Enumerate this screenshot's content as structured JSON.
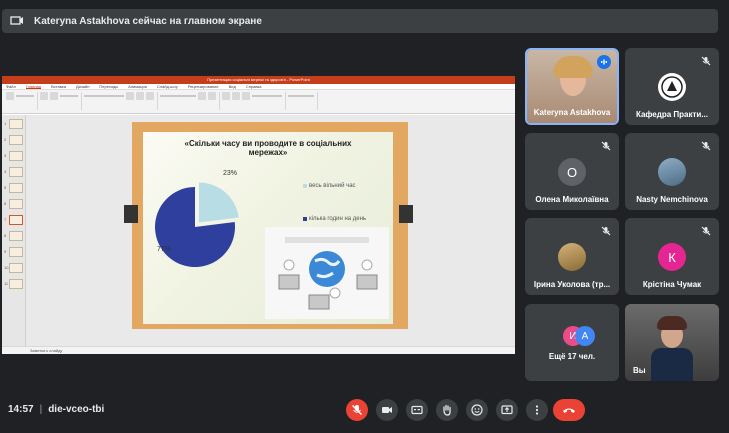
{
  "banner": {
    "text": "Kateryna Astakhova сейчас на главном экране"
  },
  "presentation": {
    "app_title": "Презентация соціальні мережі та здоров'я - PowerPoint",
    "tabs": [
      "Файл",
      "Главная",
      "Вставка",
      "Дизайн",
      "Переходы",
      "Анимация",
      "Слайд-шоу",
      "Рецензирование",
      "Вид",
      "Справка"
    ],
    "status_text": "Заметки к слайду"
  },
  "slide": {
    "title": "«Скільки часу ви проводите в соціальних мережах»",
    "legend": [
      "весь вільний час",
      "кілька годин на день"
    ],
    "pie_labels": [
      "23%",
      "77%"
    ]
  },
  "chart_data": {
    "type": "pie",
    "title": "«Скільки часу ви проводите в соціальних мережах»",
    "categories": [
      "весь вільний час",
      "кілька годин на день"
    ],
    "values": [
      23,
      77
    ],
    "colors": [
      "#b9dde5",
      "#2e3f9e"
    ],
    "legend": "right"
  },
  "participants": [
    {
      "name": "Kateryna Astakhova",
      "initial": "",
      "avatar_color": "#c9a58a",
      "speaking": true
    },
    {
      "name": "Кафедра Практи...",
      "initial": "",
      "avatar_color": "#ffffff",
      "speaking": false
    },
    {
      "name": "Олена Миколаївна",
      "initial": "О",
      "avatar_color": "#5f6368",
      "speaking": false
    },
    {
      "name": "Nasty Nemchinova",
      "initial": "",
      "avatar_color": "#6d8ca8",
      "speaking": false
    },
    {
      "name": "Ірина Уколова (тр...",
      "initial": "",
      "avatar_color": "#b08a4a",
      "speaking": false
    },
    {
      "name": "Крістіна Чумак",
      "initial": "К",
      "avatar_color": "#e52592",
      "speaking": false
    },
    {
      "name": "Ещё 17 чел.",
      "initial": "",
      "avatar_color": "",
      "speaking": false
    },
    {
      "name": "Вы",
      "initial": "",
      "avatar_color": "",
      "speaking": false
    }
  ],
  "more_avatars": [
    "И",
    "А"
  ],
  "meeting": {
    "time": "14:57",
    "separator": "|",
    "code": "die-vceo-tbi"
  },
  "controls": [
    "microphone-off",
    "camera",
    "captions",
    "raise-hand",
    "emoji",
    "present-screen",
    "more-options",
    "end-call"
  ],
  "colors": {
    "accent": "#8ab4f8",
    "danger": "#ea4335",
    "tile": "#3c4043",
    "background": "#202124"
  }
}
